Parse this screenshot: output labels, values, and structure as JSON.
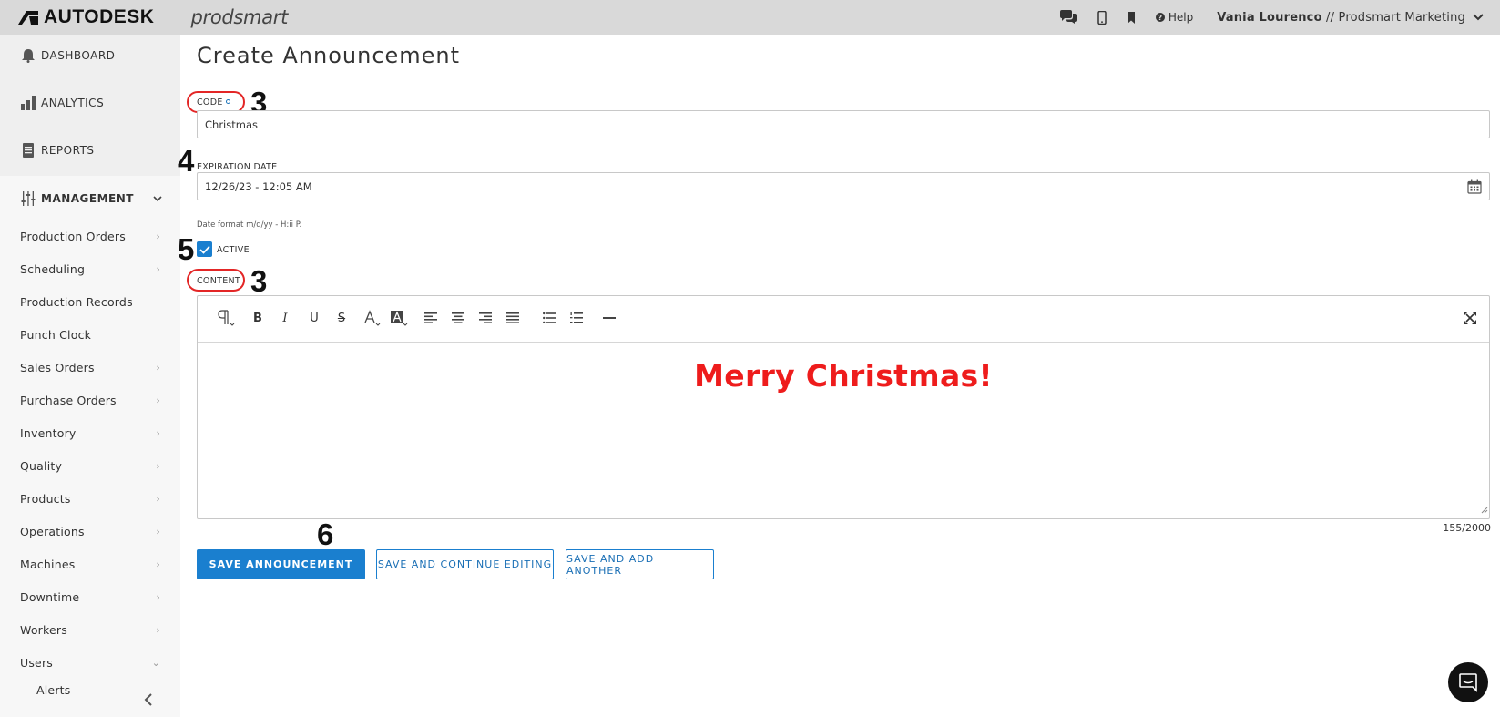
{
  "topbar": {
    "brand": "AUTODESK",
    "product": "prodsmart",
    "help_label": "Help",
    "user_name": "Vania Lourenco",
    "user_separator": " // ",
    "org_name": "Prodsmart Marketing"
  },
  "sidebar": {
    "top_items": [
      {
        "label": "DASHBOARD",
        "icon": "bell-icon"
      },
      {
        "label": "ANALYTICS",
        "icon": "bar-chart-icon"
      },
      {
        "label": "REPORTS",
        "icon": "document-icon"
      }
    ],
    "management": {
      "label": "MANAGEMENT",
      "icon": "sliders-icon",
      "items": [
        {
          "label": "Production Orders",
          "has_arrow": true
        },
        {
          "label": "Scheduling",
          "has_arrow": true
        },
        {
          "label": "Production Records",
          "has_arrow": false
        },
        {
          "label": "Punch Clock",
          "has_arrow": false
        },
        {
          "label": "Sales Orders",
          "has_arrow": true
        },
        {
          "label": "Purchase Orders",
          "has_arrow": true
        },
        {
          "label": "Inventory",
          "has_arrow": true
        },
        {
          "label": "Quality",
          "has_arrow": true
        },
        {
          "label": "Products",
          "has_arrow": true
        },
        {
          "label": "Operations",
          "has_arrow": true
        },
        {
          "label": "Machines",
          "has_arrow": true
        },
        {
          "label": "Downtime",
          "has_arrow": true
        },
        {
          "label": "Workers",
          "has_arrow": true
        },
        {
          "label": "Users",
          "has_arrow": true
        },
        {
          "label": "Alerts",
          "has_arrow": false
        }
      ]
    }
  },
  "form": {
    "title": "Create Announcement",
    "code_label": "CODE",
    "code_value": "Christmas",
    "expiration_label": "EXPIRATION DATE",
    "expiration_value": "12/26/23 - 12:05 AM",
    "date_hint": "Date format m/d/yy - H:ii P.",
    "active_label": "ACTIVE",
    "active_checked": true,
    "content_label": "CONTENT",
    "content_text": "Merry Christmas!",
    "content_color": "#ee1c1c",
    "char_counter": "155/2000",
    "toolbar_icons": [
      "paragraph-icon",
      "bold-icon",
      "italic-icon",
      "underline-icon",
      "strikethrough-icon",
      "font-color-icon",
      "highlight-icon",
      "align-left-icon",
      "align-center-icon",
      "align-right-icon",
      "align-justify-icon",
      "bullet-list-icon",
      "numbered-list-icon",
      "horizontal-rule-icon",
      "fullscreen-icon"
    ]
  },
  "buttons": {
    "save": "SAVE ANNOUNCEMENT",
    "save_continue": "SAVE AND CONTINUE EDITING",
    "save_add": "SAVE AND ADD ANOTHER"
  },
  "annotations": {
    "code_step": "3",
    "expiration_step": "4",
    "active_step": "5",
    "content_step": "3",
    "save_step": "6",
    "ring_color": "#e32626"
  },
  "colors": {
    "accent": "#1a7fcf",
    "topbar_bg": "#d9d9d9",
    "sidebar_bg": "#efefef"
  }
}
